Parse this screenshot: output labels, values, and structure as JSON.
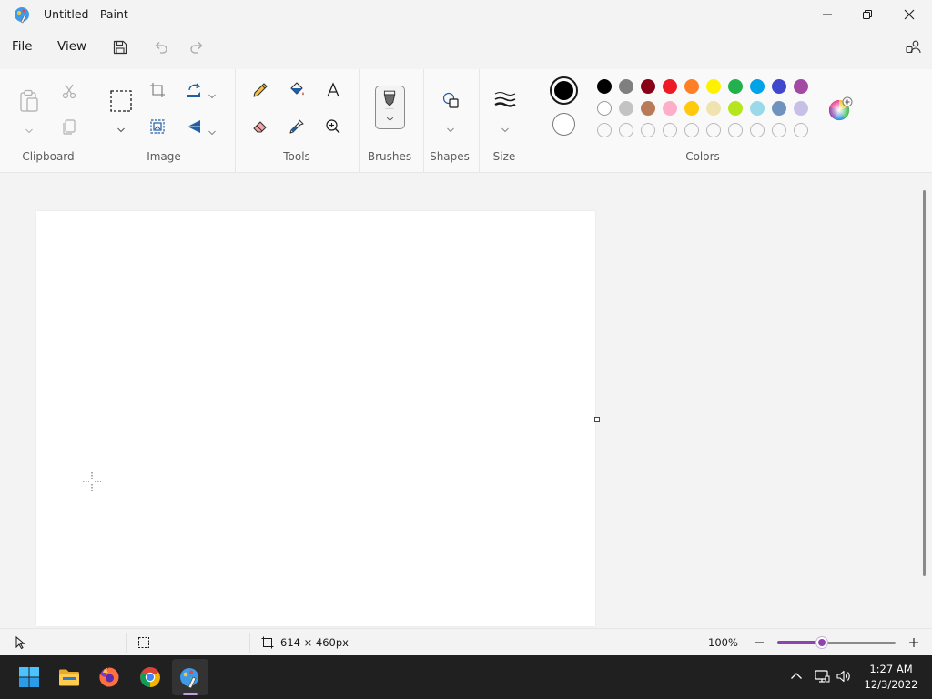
{
  "window": {
    "title": "Untitled - Paint"
  },
  "menu": {
    "file": "File",
    "view": "View"
  },
  "ribbon": {
    "groups": {
      "clipboard": "Clipboard",
      "image": "Image",
      "tools": "Tools",
      "brushes": "Brushes",
      "shapes": "Shapes",
      "size": "Size",
      "colors": "Colors"
    }
  },
  "colors": {
    "primary": "#000000",
    "secondary": "#ffffff",
    "palette_row1": [
      "#000000",
      "#7f7f7f",
      "#880015",
      "#ed1c24",
      "#ff7f27",
      "#fff200",
      "#22b14c",
      "#00a2e8",
      "#3f48cc",
      "#a349a4"
    ],
    "palette_row2": [
      "#ffffff",
      "#c3c3c3",
      "#b97a57",
      "#ffaec9",
      "#ffc90e",
      "#efe4b0",
      "#b5e61d",
      "#99d9ea",
      "#7092be",
      "#c8bfe7"
    ],
    "palette_row3_empty": 10
  },
  "status": {
    "canvas_size": "614 × 460px",
    "zoom_level": "100%",
    "zoom_fraction": 0.38
  },
  "taskbar": {
    "time": "1:27 AM",
    "date": "12/3/2022"
  }
}
